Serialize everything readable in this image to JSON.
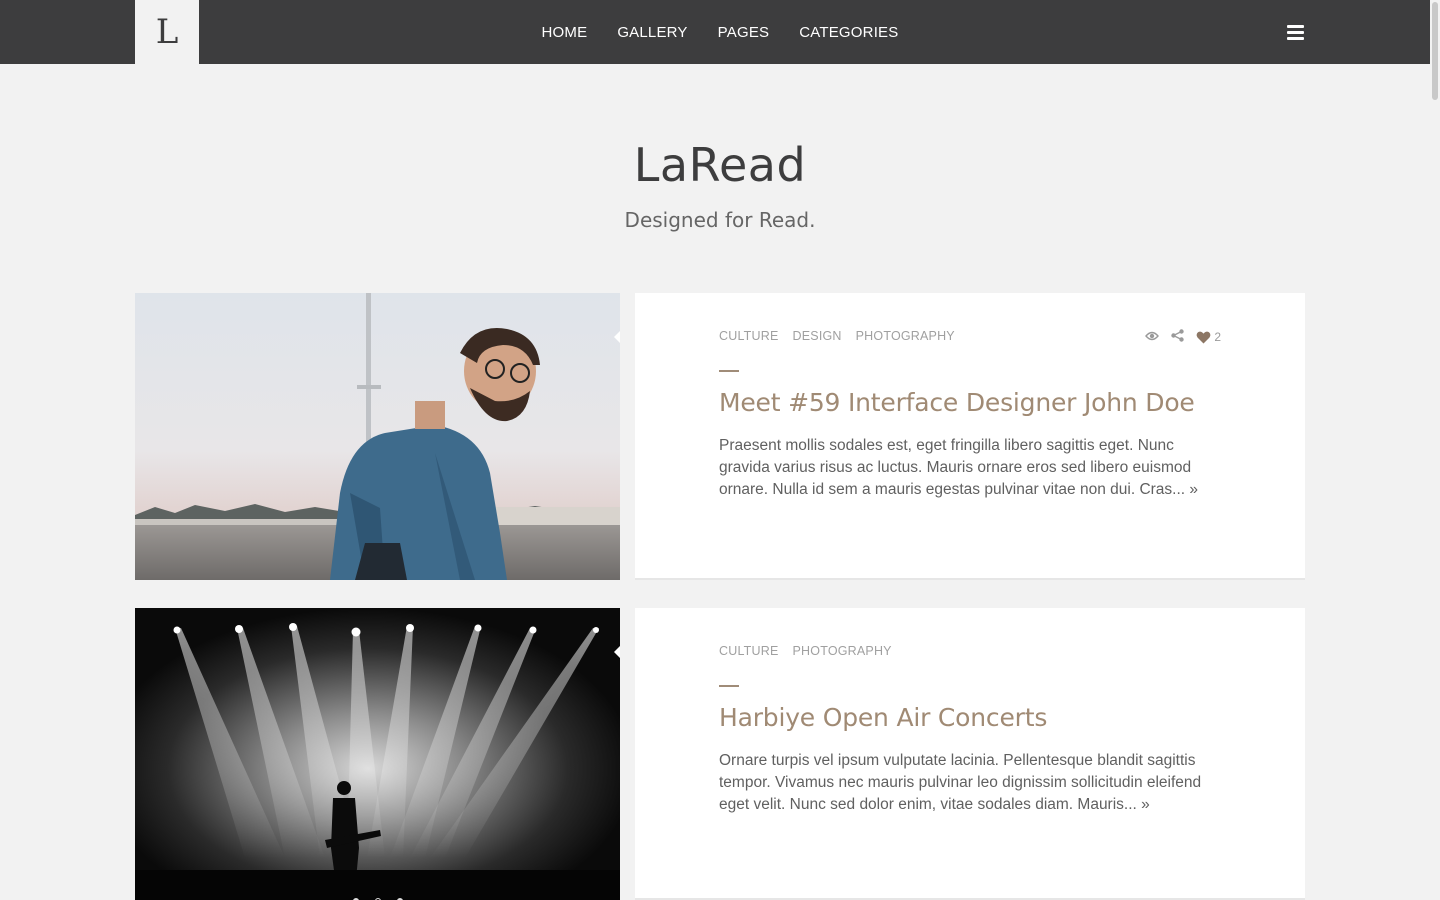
{
  "brand": {
    "logo_letter": "L"
  },
  "nav": {
    "items": [
      "HOME",
      "GALLERY",
      "PAGES",
      "CATEGORIES"
    ]
  },
  "hero": {
    "title": "LaRead",
    "subtitle": "Designed for Read."
  },
  "posts": [
    {
      "categories": [
        "CULTURE",
        "DESIGN",
        "PHOTOGRAPHY"
      ],
      "likes": "2",
      "title": "Meet #59 Interface Designer John Doe",
      "excerpt": "Praesent mollis sodales est, eget fringilla libero sagittis eget. Nunc gravida varius risus ac luctus. Mauris ornare eros sed libero euismod ornare. Nulla id sem a mauris egestas pulvinar vitae non dui. Cras...",
      "more": "»"
    },
    {
      "categories": [
        "CULTURE",
        "PHOTOGRAPHY"
      ],
      "title": "Harbiye Open Air Concerts",
      "excerpt": "Ornare turpis vel ipsum vulputate lacinia. Pellentesque blandit sagittis tempor. Vivamus nec mauris pulvinar leo dignissim sollicitudin eleifend eget velit. Nunc sed dolor enim, vitae sodales diam. Mauris...",
      "more": "»"
    }
  ],
  "icons": {
    "menu": "hamburger-icon",
    "views": "eye-icon",
    "share": "share-icon",
    "likes": "heart-icon"
  },
  "colors": {
    "topbar": "#3d3d3e",
    "background": "#f2f2f2",
    "accent": "#a08a74",
    "card": "#ffffff"
  }
}
